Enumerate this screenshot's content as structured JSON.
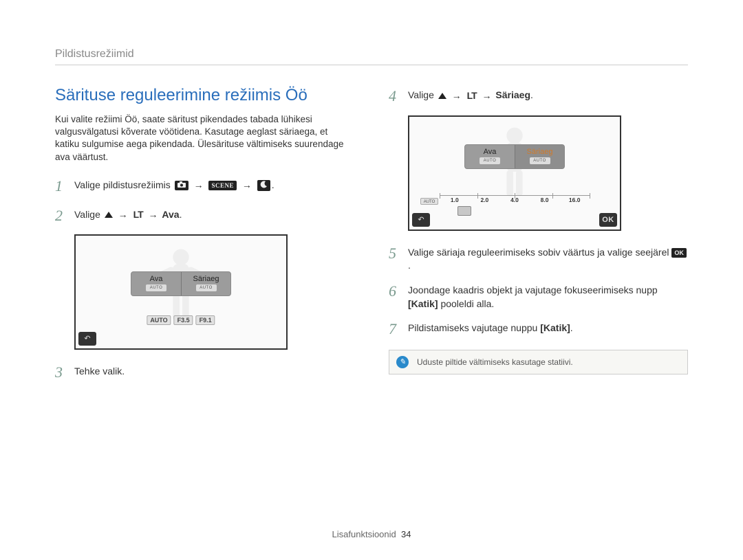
{
  "breadcrumb": "Pildistusrežiimid",
  "title": "Särituse reguleerimine režiimis Öö",
  "intro": "Kui valite režiimi Öö, saate säritust pikendades tabada lühikesi valgusvälgatusi kõverate vöötidena. Kasutage aeglast säriaega, et katiku sulgumise aega pikendada. Ülesärituse vältimiseks suurendage ava väärtust.",
  "steps_left": {
    "s1": {
      "num": "1",
      "prefix": "Valige pildistusrežiimis ",
      "chain_end": "."
    },
    "s2": {
      "num": "2",
      "prefix": "Valige ",
      "lt": "LT",
      "target": "Ava",
      "end": "."
    },
    "s3": {
      "num": "3",
      "text": "Tehke valik."
    }
  },
  "steps_right": {
    "s4": {
      "num": "4",
      "prefix": "Valige ",
      "lt": "LT",
      "target": "Säriaeg",
      "end": "."
    },
    "s5": {
      "num": "5",
      "text_a": "Valige säriaja reguleerimiseks sobiv väärtus ja valige seejärel ",
      "ok": "OK",
      "text_b": "."
    },
    "s6": {
      "num": "6",
      "text_a": "Joondage kaadris objekt ja vajutage fokuseerimiseks nupp ",
      "bold": "[Katik]",
      "text_b": " pooleldi alla."
    },
    "s7": {
      "num": "7",
      "text_a": "Pildistamiseks vajutage nuppu ",
      "bold": "[Katik]",
      "text_b": "."
    }
  },
  "screen1": {
    "tab_ava": "Ava",
    "tab_sariaeg": "Säriaeg",
    "auto": "AUTO",
    "chips": [
      "AUTO",
      "F3.5",
      "F9.1"
    ],
    "back_glyph": "↶"
  },
  "screen2": {
    "tab_ava": "Ava",
    "tab_sariaeg": "Säriaeg",
    "auto": "AUTO",
    "scale": [
      "1.0",
      "2.0",
      "4.0",
      "8.0",
      "16.0"
    ],
    "back_glyph": "↶",
    "ok": "OK"
  },
  "note": "Uduste piltide vältimiseks kasutage statiivi.",
  "footer": {
    "section": "Lisafunktsioonid",
    "page": "34"
  },
  "icons": {
    "arrow": "→",
    "scene": "SCENE",
    "camera": "◉",
    "moon": "☾"
  }
}
